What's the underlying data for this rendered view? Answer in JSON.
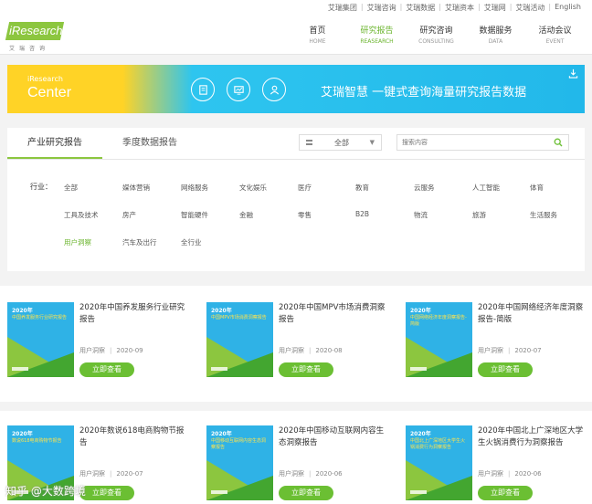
{
  "top_links": [
    "艾瑞集团",
    "艾瑞咨询",
    "艾瑞数据",
    "艾瑞资本",
    "艾瑞网",
    "艾瑞活动",
    "English"
  ],
  "logo": {
    "main": "iResearch",
    "sub": "艾瑞咨询"
  },
  "nav": [
    {
      "cn": "首页",
      "en": "HOME",
      "active": false
    },
    {
      "cn": "研究报告",
      "en": "REASEARCH",
      "active": true
    },
    {
      "cn": "研究咨询",
      "en": "CONSULTING",
      "active": false
    },
    {
      "cn": "数据服务",
      "en": "DATA",
      "active": false
    },
    {
      "cn": "活动会议",
      "en": "EVENT",
      "active": false
    }
  ],
  "banner": {
    "small": "iResearch",
    "center": "Center",
    "slogan": "艾瑞智慧  一键式查询海量研究报告数据",
    "icons": [
      "report-icon",
      "chart-icon",
      "people-icon",
      "download-icon"
    ]
  },
  "tabs": [
    "产业研究报告",
    "季度数据报告"
  ],
  "select_value": "全部",
  "search_placeholder": "搜索内容",
  "filter": {
    "label": "行业：",
    "items": [
      "全部",
      "媒体营销",
      "网络服务",
      "文化娱乐",
      "医疗",
      "教育",
      "云服务",
      "人工智能",
      "体育",
      "工具及技术",
      "房产",
      "智能硬件",
      "金融",
      "零售",
      "B2B",
      "物流",
      "旅游",
      "生活服务",
      "用户洞察",
      "汽车及出行",
      "全行业"
    ],
    "active": "用户洞察"
  },
  "cards": [
    {
      "title": "2020年中国养发服务行业研究报告",
      "thumb_year": "2020年",
      "thumb_title": "中国养发服务行业研究报告",
      "category": "用户洞察",
      "date": "2020-09",
      "button": "立即查看"
    },
    {
      "title": "2020年中国MPV市场消费洞察报告",
      "thumb_year": "2020年",
      "thumb_title": "中国MPV市场消费洞察报告",
      "category": "用户洞察",
      "date": "2020-08",
      "button": "立即查看"
    },
    {
      "title": "2020年中国网络经济年度洞察报告-简版",
      "thumb_year": "2020年",
      "thumb_title": "中国网络经济年度洞察报告-简版",
      "category": "用户洞察",
      "date": "2020-07",
      "button": "立即查看"
    },
    {
      "title": "2020年数说618电商购物节报告",
      "thumb_year": "2020年",
      "thumb_title": "数说618电商购物节报告",
      "category": "用户洞察",
      "date": "2020-07",
      "button": "立即查看"
    },
    {
      "title": "2020年中国移动互联网内容生态洞察报告",
      "thumb_year": "2020年",
      "thumb_title": "中国移动互联网内容生态洞察报告",
      "category": "用户洞察",
      "date": "2020-06",
      "button": "立即查看"
    },
    {
      "title": "2020年中国北上广深地区大学生火锅消费行为洞察报告",
      "thumb_year": "2020年",
      "thumb_title": "中国北上广深地区大学生火锅消费行为洞察报告",
      "category": "用户洞察",
      "date": "2020-06",
      "button": "立即查看"
    }
  ],
  "watermark": "知乎 @大数跨境",
  "colors": {
    "accent": "#8cc63f",
    "button": "#6bbf33",
    "banner_blue": "#22b8ea",
    "banner_yellow": "#ffd326"
  }
}
